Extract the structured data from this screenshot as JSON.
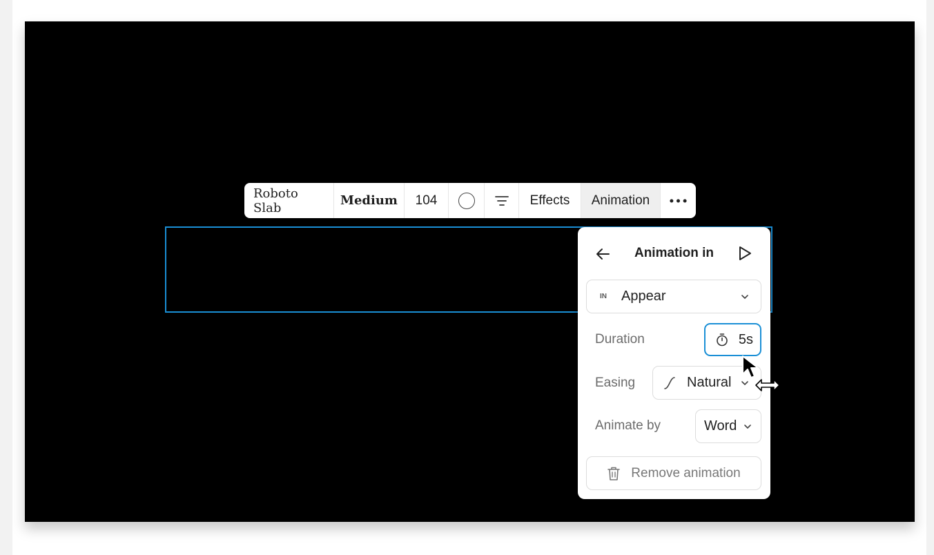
{
  "toolbar": {
    "font_family": "Roboto Slab",
    "font_weight": "Medium",
    "font_size": "104",
    "color_icon": "circle-outline",
    "align_icon": "align-center-lines",
    "effects_label": "Effects",
    "animation_label": "Animation",
    "more_icon": "ellipsis-horizontal"
  },
  "panel": {
    "title": "Animation in",
    "back_icon": "arrow-left",
    "play_icon": "play-outline",
    "animation_type": {
      "badge": "IN",
      "value": "Appear"
    },
    "duration": {
      "label": "Duration",
      "value": "5s",
      "icon": "timer"
    },
    "easing": {
      "label": "Easing",
      "value": "Natural",
      "icon": "easing-curve"
    },
    "animate_by": {
      "label": "Animate by",
      "value": "Word"
    },
    "remove": {
      "label": "Remove animation",
      "icon": "trash"
    }
  },
  "colors": {
    "canvas": "#000000",
    "selection": "#1a8fd6",
    "panel_bg": "#ffffff",
    "active_tab": "#efefef"
  }
}
